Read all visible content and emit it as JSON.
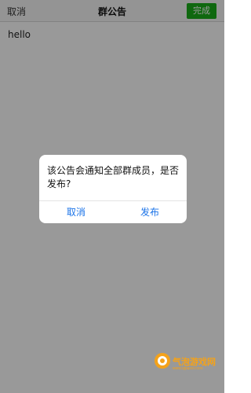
{
  "nav": {
    "cancel_label": "取消",
    "title": "群公告",
    "done_label": "完成"
  },
  "content": {
    "text": "hello"
  },
  "dialog": {
    "message": "该公告会通知全部群成员，是否发布?",
    "cancel_label": "取消",
    "publish_label": "发布"
  },
  "watermark": {
    "text": "气泡游戏网",
    "subtext": "www.qipaoxi.com"
  },
  "colors": {
    "done_button": "#1aad19",
    "dialog_action": "#1a73e8",
    "watermark": "#f4a21a"
  },
  "icons": {
    "watermark_logo": "bubble-logo-icon"
  }
}
